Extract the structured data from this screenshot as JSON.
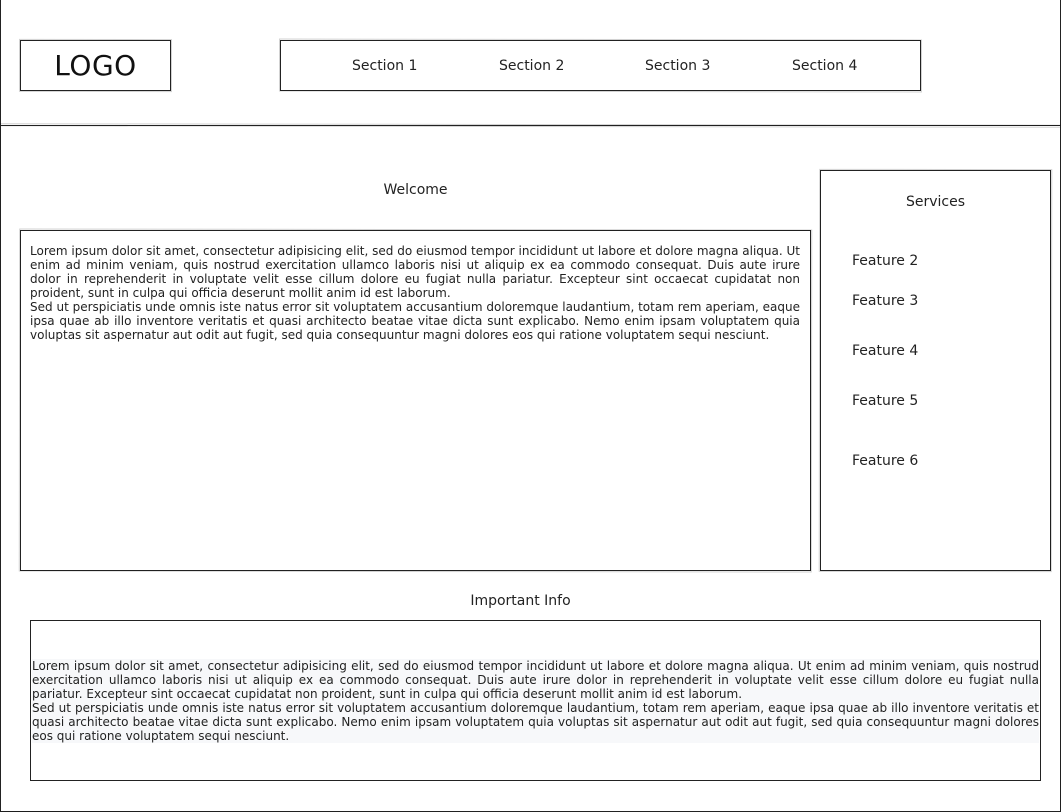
{
  "header": {
    "logo": "LOGO",
    "nav": [
      "Section 1",
      "Section 2",
      "Section 3",
      "Section 4"
    ]
  },
  "welcome": {
    "title": "Welcome",
    "paragraphs": [
      "Lorem ipsum dolor sit amet, consectetur adipisicing elit, sed do eiusmod tempor incididunt ut labore et dolore magna aliqua. Ut enim ad minim veniam, quis nostrud exercitation ullamco laboris nisi ut aliquip ex ea commodo consequat. Duis aute irure dolor in reprehenderit in voluptate velit esse cillum dolore eu fugiat nulla pariatur. Excepteur sint occaecat cupidatat non proident, sunt in culpa qui officia deserunt mollit anim id est laborum.",
      "Sed ut perspiciatis unde omnis iste natus error sit voluptatem accusantium doloremque laudantium, totam rem aperiam, eaque ipsa quae ab illo inventore veritatis et quasi architecto beatae vitae dicta sunt explicabo. Nemo enim ipsam voluptatem quia voluptas sit aspernatur aut odit aut fugit, sed quia consequuntur magni dolores eos qui ratione voluptatem sequi nesciunt."
    ]
  },
  "services": {
    "title": "Services",
    "features": [
      "Feature 2",
      "Feature 3",
      "Feature 4",
      "Feature 5",
      "Feature 6"
    ]
  },
  "info": {
    "title": "Important Info",
    "paragraphs": [
      "Lorem ipsum dolor sit amet, consectetur adipisicing elit, sed do eiusmod tempor incididunt ut labore et dolore magna aliqua. Ut enim ad minim veniam, quis nostrud exercitation ullamco laboris nisi ut aliquip ex ea commodo consequat. Duis aute irure dolor in reprehenderit in voluptate velit esse cillum dolore eu fugiat nulla pariatur. Excepteur sint occaecat cupidatat non proident, sunt in culpa qui officia deserunt mollit anim id est laborum.",
      "Sed ut perspiciatis unde omnis iste natus error sit voluptatem accusantium doloremque laudantium, totam rem aperiam, eaque ipsa quae ab illo inventore veritatis et quasi architecto beatae vitae dicta sunt explicabo. Nemo enim ipsam voluptatem quia voluptas sit aspernatur aut odit aut fugit, sed quia consequuntur magni dolores eos qui ratione voluptatem sequi nesciunt."
    ]
  }
}
